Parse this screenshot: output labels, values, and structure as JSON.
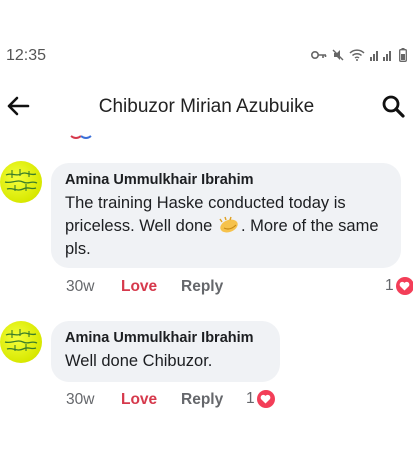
{
  "status": {
    "time": "12:35"
  },
  "header": {
    "title": "Chibuzor Mirian Azubuike"
  },
  "comments": [
    {
      "author": "Amina Ummulkhair Ibrahim",
      "text_before_emoji": "The training Haske conducted today is priceless. Well done ",
      "text_after_emoji": ". More of the same pls.",
      "time": "30w",
      "love_label": "Love",
      "reply_label": "Reply",
      "reaction_count": "1"
    },
    {
      "author": "Amina Ummulkhair Ibrahim",
      "text_before_emoji": "Well done Chibuzor.",
      "text_after_emoji": "",
      "time": "30w",
      "love_label": "Love",
      "reply_label": "Reply",
      "reaction_count": "1"
    }
  ],
  "colors": {
    "love": "#d6394c",
    "bubble": "#f0f2f5",
    "heart": "#f33e58"
  }
}
